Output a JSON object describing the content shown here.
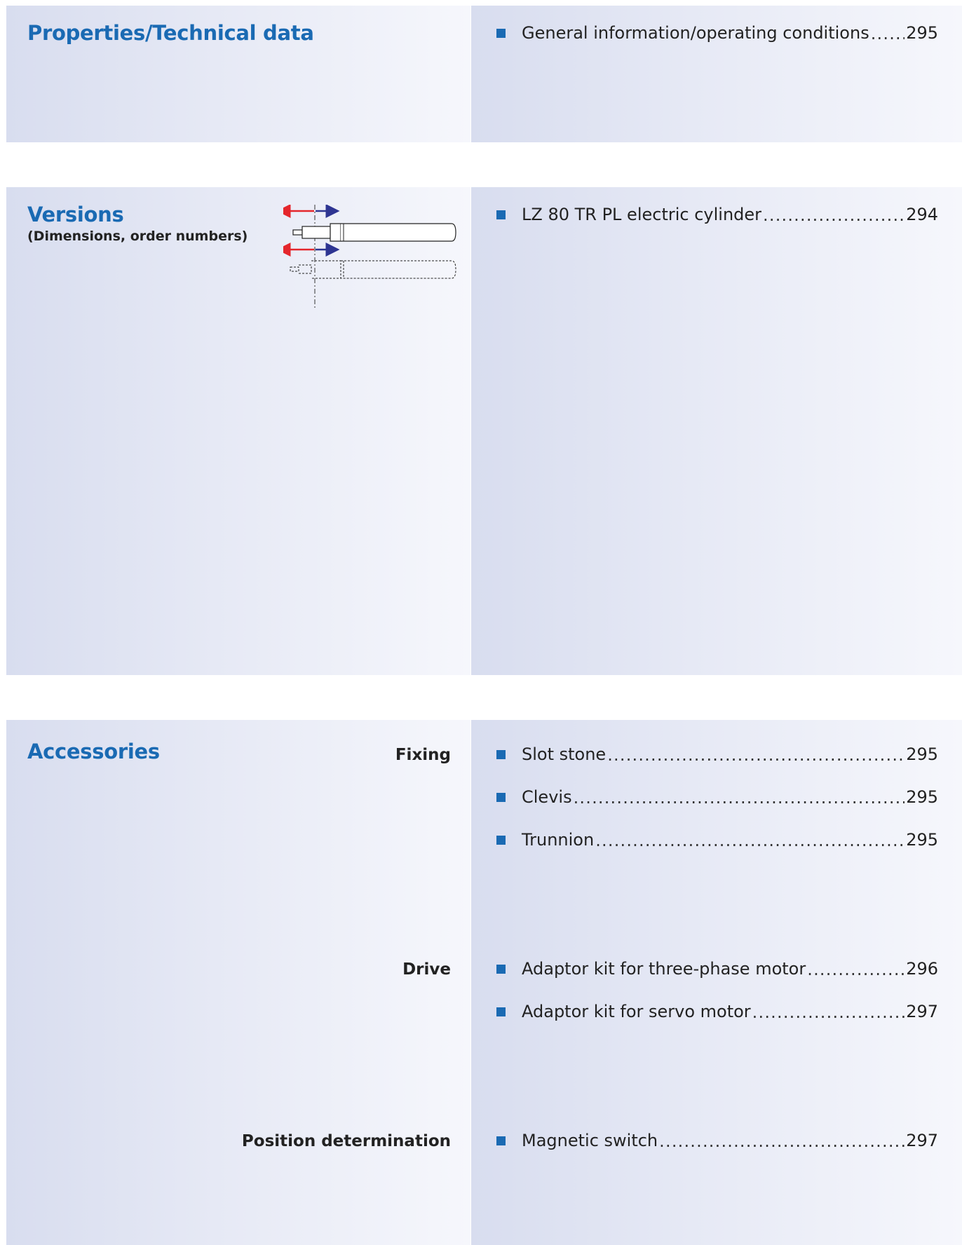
{
  "sections": {
    "properties": {
      "title": "Properties/Technical data",
      "entries": [
        {
          "label": "General information/operating conditions",
          "page": "295"
        }
      ]
    },
    "versions": {
      "title": "Versions",
      "subtitle": "(Dimensions, order numbers)",
      "entries": [
        {
          "label": "LZ 80 TR PL electric cylinder",
          "page": "294"
        }
      ]
    },
    "accessories": {
      "title": "Accessories",
      "groups": [
        {
          "category": "Fixing",
          "entries": [
            {
              "label": "Slot stone",
              "page": "295"
            },
            {
              "label": "Clevis",
              "page": "295"
            },
            {
              "label": "Trunnion",
              "page": "295"
            }
          ]
        },
        {
          "category": "Drive",
          "entries": [
            {
              "label": "Adaptor kit for three-phase motor",
              "page": "296"
            },
            {
              "label": "Adaptor kit for servo motor",
              "page": "297"
            }
          ]
        },
        {
          "category": "Position determination",
          "entries": [
            {
              "label": "Magnetic switch",
              "page": "297"
            }
          ]
        }
      ]
    }
  },
  "colors": {
    "accent": "#1a6ab3",
    "arrow_left": "#e4262c",
    "arrow_right": "#2e3592"
  },
  "icons": {
    "bullet": "blue-square-bullet-icon",
    "diagram": "electric-cylinder-extend-retract-icon"
  }
}
